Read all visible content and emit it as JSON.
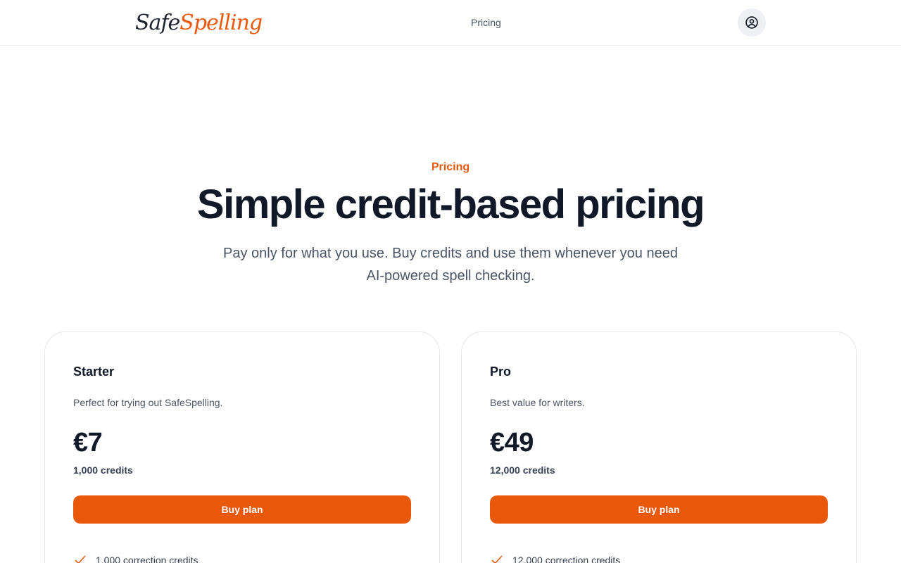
{
  "header": {
    "logo": {
      "part1": "Safe",
      "part2": "Spelling"
    },
    "nav": {
      "pricing_label": "Pricing"
    },
    "account_icon": "user-circle-icon"
  },
  "hero": {
    "eyebrow": "Pricing",
    "title": "Simple credit-based pricing",
    "subtitle": "Pay only for what you use. Buy credits and use them whenever you need AI-powered spell checking."
  },
  "plans": [
    {
      "name": "Starter",
      "description": "Perfect for trying out SafeSpelling.",
      "price": "€7",
      "credits": "1,000 credits",
      "button_label": "Buy plan",
      "features": [
        "1,000 correction credits"
      ]
    },
    {
      "name": "Pro",
      "description": "Best value for writers.",
      "price": "€49",
      "credits": "12,000 credits",
      "button_label": "Buy plan",
      "features": [
        "12,000 correction credits"
      ]
    }
  ],
  "colors": {
    "accent": "#e8590c",
    "text_primary": "#111827",
    "text_secondary": "#4b5563"
  }
}
